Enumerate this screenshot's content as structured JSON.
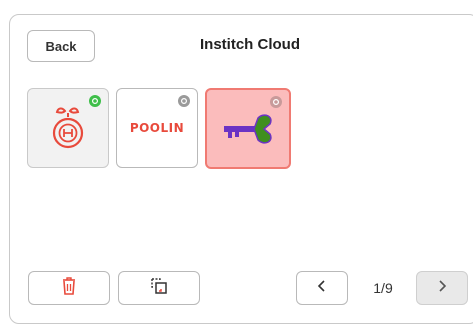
{
  "header": {
    "back_label": "Back",
    "title": "Institch Cloud"
  },
  "tiles": [
    {
      "icon": "red-apple-logo-icon",
      "status": "synced",
      "status_color": "#3fbf4a",
      "selected": false
    },
    {
      "icon": "poolin-logo",
      "logo_text": "POOLIN",
      "status": "not-synced",
      "status_color": "#9a9a9a",
      "selected": false
    },
    {
      "icon": "heart-key-icon",
      "status": "not-synced",
      "status_color": "#9a9a9a",
      "selected": true
    }
  ],
  "pagination": {
    "page": "1/9",
    "prev_icon": "chevron-left-icon",
    "next_icon": "chevron-right-icon"
  },
  "toolbar": {
    "delete_icon": "trash-icon",
    "copy_icon": "copy-icon"
  },
  "colors": {
    "selected_fill": "#fbbcbc",
    "selected_border": "#f07a72",
    "key_purple": "#6b33c4",
    "key_green": "#3f8f1f",
    "apple_red": "#e84a3c"
  }
}
